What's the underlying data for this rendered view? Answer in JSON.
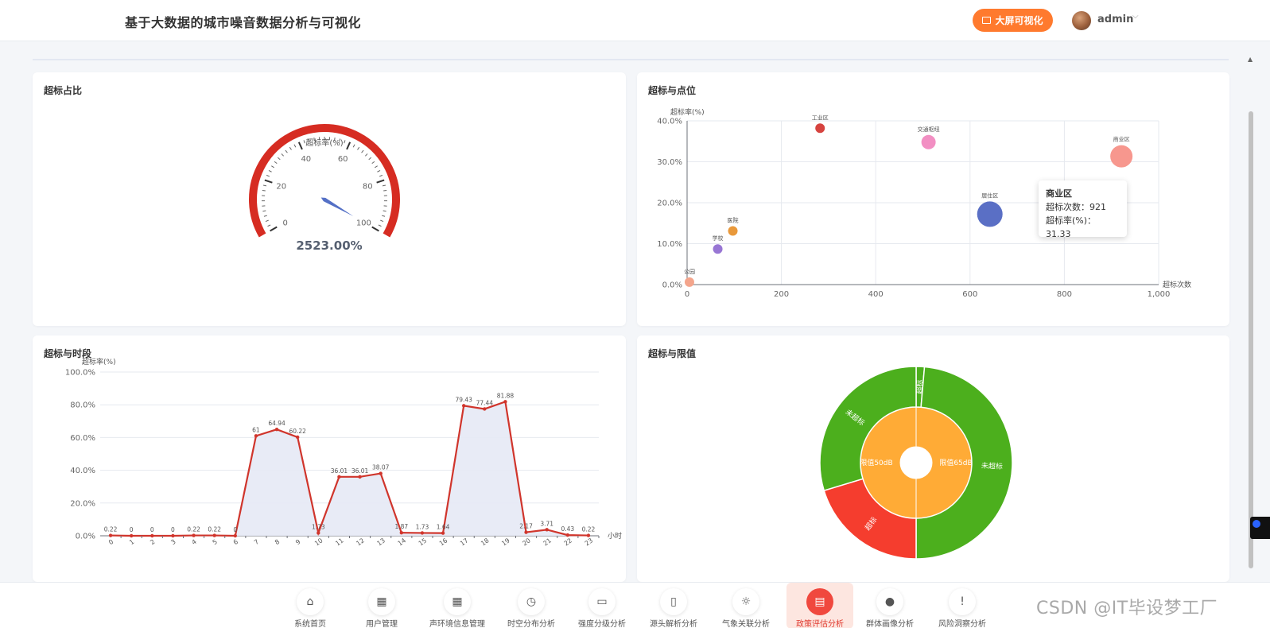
{
  "header": {
    "title": "基于大数据的城市噪音数据分析与可视化",
    "bigscreen_label": "大屏可视化",
    "username": "admin"
  },
  "gauge_card": {
    "title": "超标占比",
    "gauge_name": "超标率(%)",
    "value_text": "2523.00%",
    "ticks": [
      "0",
      "20",
      "40",
      "60",
      "80",
      "100"
    ]
  },
  "scatter_card": {
    "title": "超标与点位"
  },
  "tooltip": {
    "name": "商业区",
    "row1": "超标次数：921",
    "row2": "超标率(%)：31.33"
  },
  "line_card": {
    "title": "超标与时段"
  },
  "sunburst_card": {
    "title": "超标与限值"
  },
  "colors": {
    "accent": "#ff7a2e",
    "gauge_red": "#d62c22",
    "line_red": "#d0352c",
    "area_fill": "#e6e9f5",
    "green": "#4caf1d",
    "orange": "#ffab36",
    "red": "#f53d2e",
    "active_nav": "#f0483e"
  },
  "nav": [
    {
      "label": "系统首页",
      "icon": "home-icon"
    },
    {
      "label": "用户管理",
      "icon": "grid-icon"
    },
    {
      "label": "声环境信息管理",
      "icon": "grid-icon"
    },
    {
      "label": "时空分布分析",
      "icon": "clock-icon"
    },
    {
      "label": "强度分级分析",
      "icon": "presentation-icon"
    },
    {
      "label": "源头解析分析",
      "icon": "book-icon"
    },
    {
      "label": "气象关联分析",
      "icon": "sun-icon"
    },
    {
      "label": "政策评估分析",
      "icon": "document-icon",
      "active": true
    },
    {
      "label": "群体画像分析",
      "icon": "user-icon"
    },
    {
      "label": "风险洞察分析",
      "icon": "alert-icon"
    }
  ],
  "watermark": "CSDN @IT毕设梦工厂",
  "chart_data": [
    {
      "type": "gauge",
      "title": "超标占比",
      "name": "超标率(%)",
      "min": 0,
      "max": 100,
      "value": 2523,
      "display": "2523.00%"
    },
    {
      "type": "scatter",
      "title": "超标与点位",
      "xlabel": "超标次数",
      "ylabel": "超标率(%)",
      "xlim": [
        0,
        1000
      ],
      "ylim": [
        0,
        40
      ],
      "xticks": [
        "0",
        "200",
        "400",
        "600",
        "800",
        "1,000"
      ],
      "yticks": [
        "0.0%",
        "10.0%",
        "20.0%",
        "30.0%",
        "40.0%"
      ],
      "points": [
        {
          "label": "公园",
          "x": 5,
          "y": 0.6,
          "color": "#f4a58c",
          "size": 6
        },
        {
          "label": "学校",
          "x": 65,
          "y": 8.7,
          "color": "#9876d4",
          "size": 6
        },
        {
          "label": "医院",
          "x": 97,
          "y": 13.1,
          "color": "#e9993b",
          "size": 6
        },
        {
          "label": "工业区",
          "x": 282,
          "y": 38.2,
          "color": "#d6433f",
          "size": 6
        },
        {
          "label": "交通枢纽",
          "x": 512,
          "y": 34.8,
          "color": "#f28fc3",
          "size": 9
        },
        {
          "label": "居住区",
          "x": 642,
          "y": 17.2,
          "color": "#5a6fc5",
          "size": 16
        },
        {
          "label": "商业区",
          "x": 921,
          "y": 31.33,
          "color": "#f7978e",
          "size": 14
        }
      ]
    },
    {
      "type": "line",
      "title": "超标与时段",
      "xlabel": "小时",
      "ylabel": "超标率(%)",
      "ylim": [
        0,
        100
      ],
      "yticks": [
        "0.0%",
        "20.0%",
        "40.0%",
        "60.0%",
        "80.0%",
        "100.0%"
      ],
      "x": [
        "0",
        "1",
        "2",
        "3",
        "4",
        "5",
        "6",
        "7",
        "8",
        "9",
        "10",
        "11",
        "12",
        "13",
        "14",
        "15",
        "16",
        "17",
        "18",
        "19",
        "20",
        "21",
        "22",
        "23"
      ],
      "labels": [
        "0.22",
        "0",
        "0",
        "0",
        "0.22",
        "0.22",
        "0",
        "61",
        "64.94",
        "60.22",
        "1.73",
        "36.01",
        "36.01",
        "38.07",
        "1.87",
        "1.73",
        "1.64",
        "79.43",
        "77.44",
        "81.88",
        "2.17",
        "3.71",
        "0.43",
        "0.22"
      ],
      "values": [
        0.22,
        0,
        0,
        0,
        0.22,
        0.22,
        0,
        61,
        64.94,
        60.22,
        1.73,
        36.01,
        36.01,
        38.07,
        1.87,
        1.73,
        1.64,
        79.43,
        77.44,
        81.88,
        2.17,
        3.71,
        0.43,
        0.22
      ]
    },
    {
      "type": "sunburst",
      "title": "超标与限值",
      "inner": [
        {
          "name": "限值50dB",
          "value": 50,
          "color": "#ffab36"
        },
        {
          "name": "限值65dB",
          "value": 50,
          "color": "#ffab36"
        }
      ],
      "outer": [
        {
          "parent": "限值65dB",
          "name": "超标",
          "value": 1,
          "color": "#4caf1d"
        },
        {
          "parent": "限值65dB",
          "name": "未超标",
          "value": 35,
          "color": "#4caf1d"
        },
        {
          "parent": "限值50dB",
          "name": "超标",
          "value": 26,
          "color": "#f53d2e"
        },
        {
          "parent": "限值50dB",
          "name": "未超标",
          "value": 38,
          "color": "#4caf1d"
        }
      ]
    }
  ]
}
